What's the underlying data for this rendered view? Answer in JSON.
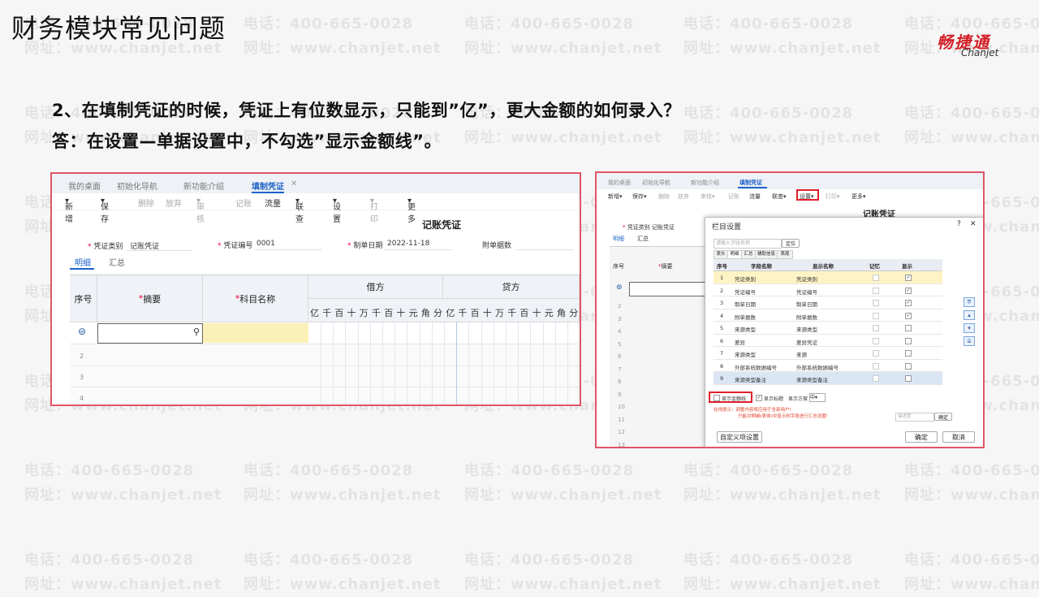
{
  "watermark": {
    "phone": "电话：400-665-0028",
    "site": "网址：www.chanjet.net"
  },
  "page": {
    "title": "财务模块常见问题",
    "question": "2、在填制凭证的时候，凭证上有位数显示，只能到”亿”，更大金额的如何录入？",
    "answer": "答：在设置—单据设置中，不勾选”显示金额线”。"
  },
  "logo": {
    "cn": "畅捷通",
    "en": "Chanjet"
  },
  "left_shot": {
    "tabs": [
      "我的桌面",
      "初始化导航",
      "新功能介绍",
      "填制凭证"
    ],
    "toolbar": [
      "新增",
      "保存",
      "删除",
      "放弃",
      "审核",
      "记账",
      "流量",
      "联查",
      "设置",
      "打印",
      "更多"
    ],
    "voucher_title": "记账凭证",
    "fields": {
      "type_label": "凭证类别",
      "type_value": "记账凭证",
      "no_label": "凭证编号",
      "no_value": "0001",
      "date_label": "制单日期",
      "date_value": "2022-11-18",
      "attach_label": "附单据数"
    },
    "subtabs": [
      "明细",
      "汇总"
    ],
    "headers": {
      "seq": "序号",
      "summary": "摘要",
      "account": "科目名称",
      "debit": "借方",
      "credit": "贷方"
    },
    "digits": [
      "亿",
      "千",
      "百",
      "十",
      "万",
      "千",
      "百",
      "十",
      "元",
      "角",
      "分"
    ],
    "rows": [
      "2",
      "3",
      "4"
    ]
  },
  "right_shot": {
    "tabs": [
      "我的桌面",
      "初始化导航",
      "新功能介绍",
      "填制凭证"
    ],
    "toolbar": [
      "新增",
      "保存",
      "删除",
      "放弃",
      "审核",
      "记账",
      "流量",
      "联查",
      "设置",
      "打印",
      "更多"
    ],
    "voucher_title": "记账凭证",
    "side_labels": {
      "type": "凭证类别",
      "type_value": "记账凭证",
      "detail": "明细",
      "summary_tab": "汇总",
      "seq": "序号",
      "summary": "摘要"
    },
    "row_numbers": [
      "2",
      "3",
      "4",
      "5",
      "6",
      "7",
      "8",
      "9",
      "10",
      "11",
      "12",
      "13"
    ],
    "dialog": {
      "title": "栏目设置",
      "search_placeholder": "请输入字段名称",
      "locate": "定位",
      "tabs": [
        "表头",
        "明细",
        "汇总",
        "辅助信息",
        "表尾"
      ],
      "columns": [
        "序号",
        "字段名称",
        "显示名称",
        "记忆",
        "显示"
      ],
      "rows": [
        {
          "no": "1",
          "field": "凭证类别",
          "display": "凭证类别",
          "remember": false,
          "show": true
        },
        {
          "no": "2",
          "field": "凭证编号",
          "display": "凭证编号",
          "remember": false,
          "show": true
        },
        {
          "no": "3",
          "field": "制单日期",
          "display": "制单日期",
          "remember": false,
          "show": true
        },
        {
          "no": "4",
          "field": "附单据数",
          "display": "附单据数",
          "remember": false,
          "show": true
        },
        {
          "no": "5",
          "field": "来源类型",
          "display": "来源类型",
          "remember": false,
          "show": false
        },
        {
          "no": "6",
          "field": "差异",
          "display": "差异凭证",
          "remember": false,
          "show": false
        },
        {
          "no": "7",
          "field": "来源类型",
          "display": "来源",
          "remember": false,
          "show": false
        },
        {
          "no": "8",
          "field": "外部系统数据编号",
          "display": "外部系统数据编号",
          "remember": false,
          "show": false
        },
        {
          "no": "9",
          "field": "来源类型备注",
          "display": "来源类型备注",
          "remember": false,
          "show": false
        }
      ],
      "show_amount_line": "显示金额线",
      "show_title": "显示标题",
      "display_scheme": "显示方案",
      "scheme_value": "中",
      "tip1": "在线提示：调整内容将应用于全部用户!",
      "tip2": "只能对明细(表体)中显示的字段进行汇总设置!",
      "width_placeholder": "描述宽",
      "confirm_small": "确定",
      "custom": "自定义项设置",
      "ok": "确定",
      "cancel": "取消"
    }
  },
  "colors": {
    "accent": "#1f62c8",
    "highlight_border": "#e05566",
    "logo_red": "#d41f27"
  }
}
